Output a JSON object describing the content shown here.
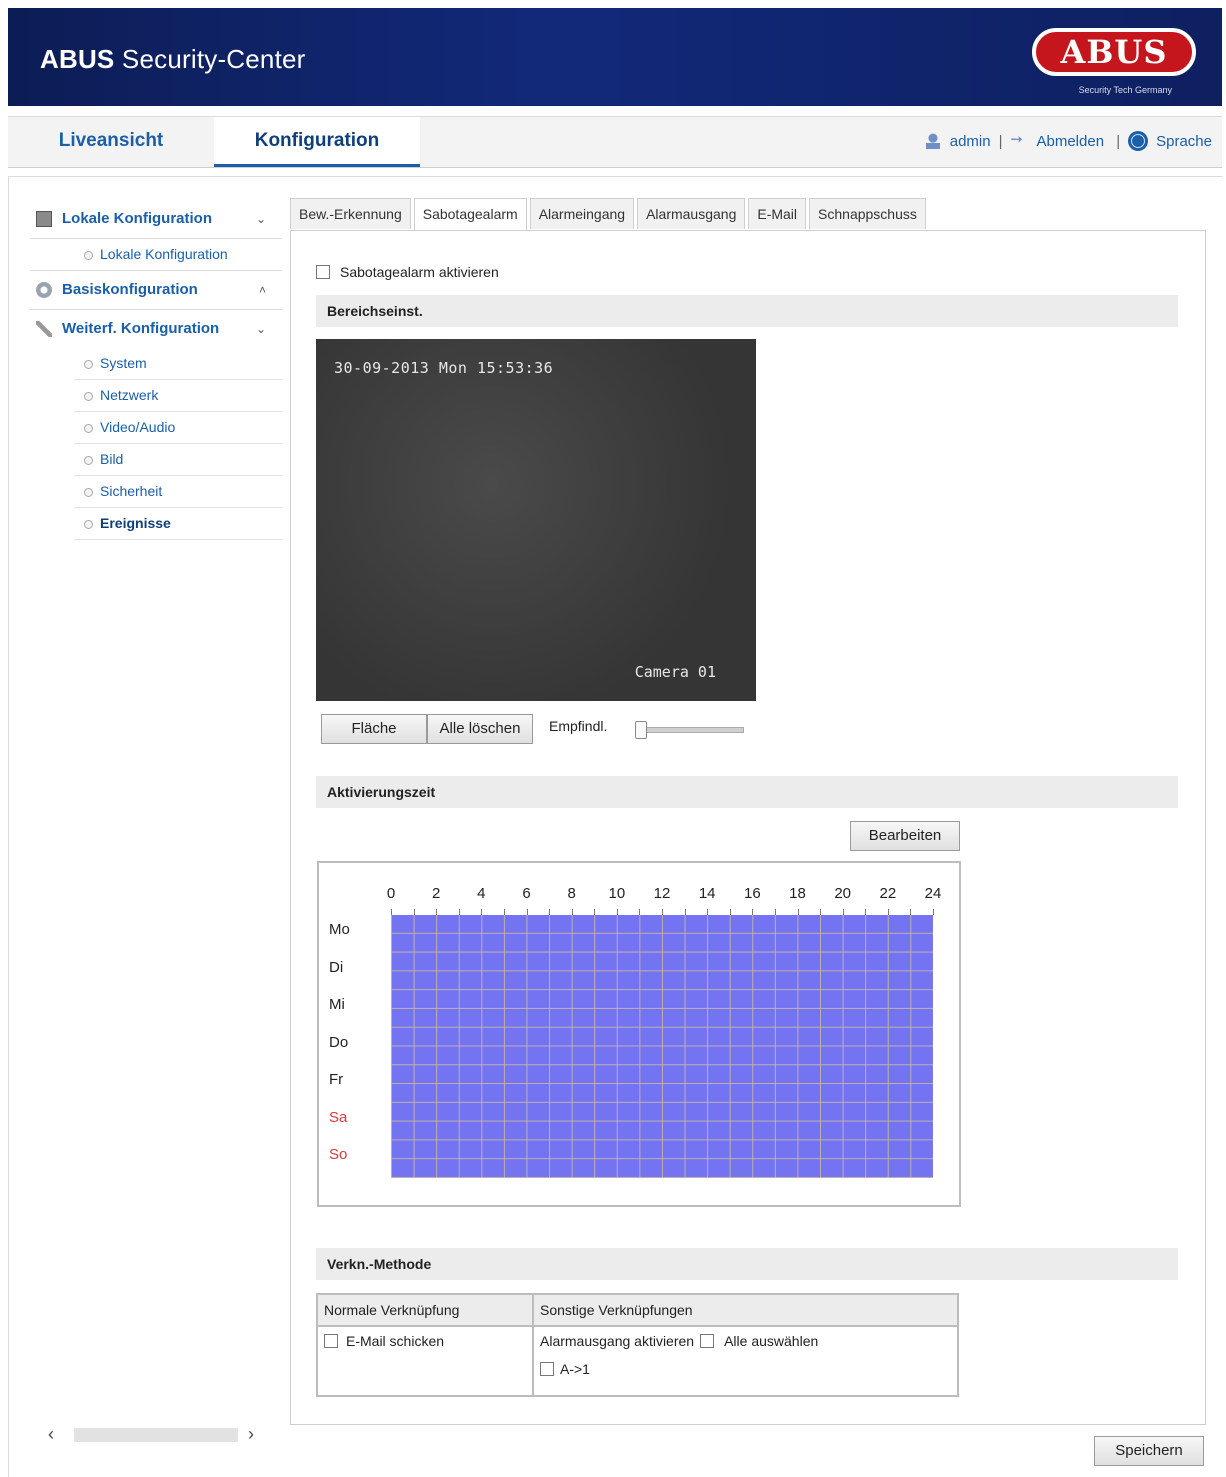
{
  "header": {
    "app_title_brand": "ABUS",
    "app_title_rest": "Security-Center",
    "logo_text": "ABUS",
    "logo_subtitle": "Security Tech Germany",
    "brand_color": "#c4161c",
    "banner_color": "#12297a"
  },
  "topnav": {
    "tabs": [
      {
        "label": "Liveansicht"
      },
      {
        "label": "Konfiguration"
      }
    ],
    "user": "admin",
    "logout": "Abmelden",
    "language": "Sprache"
  },
  "sidebar": {
    "sections": [
      {
        "label": "Lokale Konfiguration",
        "icon": "local-config-icon",
        "chevron": "⌄",
        "items": [
          {
            "label": "Lokale Konfiguration"
          }
        ]
      },
      {
        "label": "Basiskonfiguration",
        "icon": "basic-config-icon",
        "chevron": "˄"
      },
      {
        "label": "Weiterf. Konfiguration",
        "icon": "wrench-icon",
        "chevron": "⌄",
        "items": [
          {
            "label": "System"
          },
          {
            "label": "Netzwerk"
          },
          {
            "label": "Video/Audio"
          },
          {
            "label": "Bild"
          },
          {
            "label": "Sicherheit"
          },
          {
            "label": "Ereignisse"
          }
        ]
      }
    ],
    "active_item": "Ereignisse"
  },
  "tabs": [
    {
      "label": "Bew.-Erkennung"
    },
    {
      "label": "Sabotagealarm"
    },
    {
      "label": "Alarmeingang"
    },
    {
      "label": "Alarmausgang"
    },
    {
      "label": "E-Mail"
    },
    {
      "label": "Schnappschuss"
    }
  ],
  "active_tab": "Sabotagealarm",
  "content": {
    "enable_label": "Sabotagealarm aktivieren",
    "enable_checked": false,
    "area_section": "Bereichseinst.",
    "video": {
      "osd_datetime": "30-09-2013 Mon 15:53:36",
      "osd_camera": "Camera 01"
    },
    "area_button": "Fläche",
    "clear_button": "Alle löschen",
    "sensitivity_label": "Empfindl.",
    "sensitivity_value": 0,
    "schedule_section": "Aktivierungszeit",
    "edit_button": "Bearbeiten",
    "schedule": {
      "hours": [
        "0",
        "2",
        "4",
        "6",
        "8",
        "10",
        "12",
        "14",
        "16",
        "18",
        "20",
        "22",
        "24"
      ],
      "days": [
        "Mo",
        "Di",
        "Mi",
        "Do",
        "Fr",
        "Sa",
        "So"
      ],
      "weekend_days": [
        "Sa",
        "So"
      ],
      "active_all_day": true,
      "active_color": "#7474f2",
      "weekend_color": "#d63a3a"
    },
    "link_section": "Verkn.-Methode",
    "link_table": {
      "col_normal": "Normale Verknüpfung",
      "col_other": "Sonstige Verknüpfungen",
      "email_label": "E-Mail schicken",
      "alarm_out_label": "Alarmausgang aktivieren",
      "select_all_label": "Alle auswählen",
      "output_label": "A->1"
    },
    "save_button": "Speichern"
  }
}
